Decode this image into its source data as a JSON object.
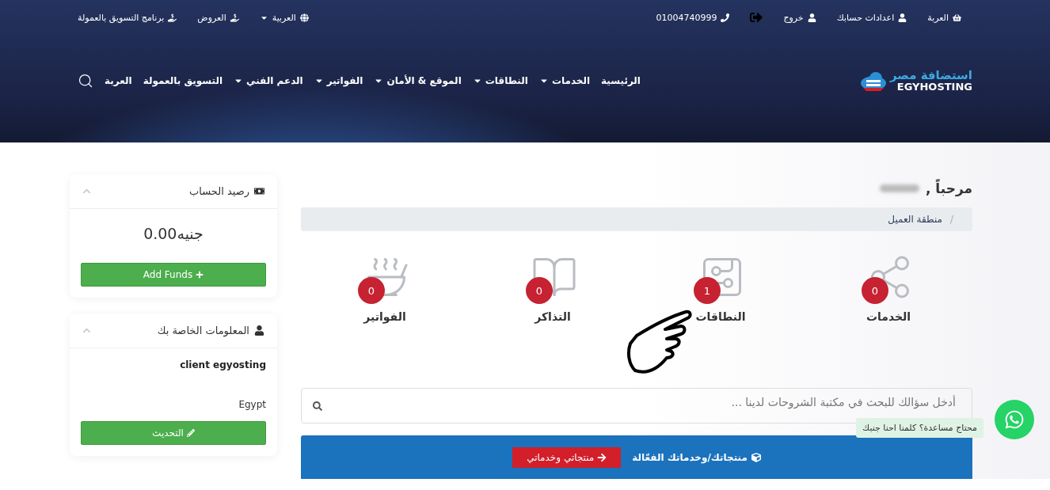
{
  "top_bar": {
    "right": [
      {
        "kind": "basket",
        "label": "العربة"
      },
      {
        "kind": "user",
        "label": "اعدادات حسابك"
      },
      {
        "kind": "user",
        "label": "خروج"
      },
      {
        "kind": "logout"
      },
      {
        "kind": "phone",
        "label": "01004740999"
      }
    ],
    "left": [
      {
        "kind": "globe",
        "label": "العربية",
        "dropdown": true
      },
      {
        "kind": "offer",
        "label": "العروض",
        "dropdown": false
      },
      {
        "kind": "offer",
        "label": "برنامج التسويق بالعمولة",
        "dropdown": false
      }
    ]
  },
  "logo": {
    "arabic": "استضافة مصر",
    "latin": "EGYHOSTING"
  },
  "nav": [
    {
      "label": "الرئيسية",
      "dropdown": false
    },
    {
      "label": "الخدمات",
      "dropdown": true
    },
    {
      "label": "النطاقات",
      "dropdown": true
    },
    {
      "label": "الموقع & الأمان",
      "dropdown": true
    },
    {
      "label": "الفواتير",
      "dropdown": true
    },
    {
      "label": "الدعم الفني",
      "dropdown": true
    },
    {
      "label": "التسويق بالعمولة",
      "dropdown": false
    },
    {
      "label": "العربة",
      "dropdown": false
    }
  ],
  "greeting": "مرحباً ,",
  "breadcrumb_separator": "/",
  "breadcrumb": [
    "منطقة العميل"
  ],
  "stats": [
    {
      "kind": "services",
      "count": "0",
      "label": "الخدمات"
    },
    {
      "kind": "domains",
      "count": "1",
      "label": "النطاقات"
    },
    {
      "kind": "tickets",
      "count": "0",
      "label": "التذاكر"
    },
    {
      "kind": "invoices",
      "count": "0",
      "label": "الفواتير"
    }
  ],
  "search": {
    "placeholder": "أدخل سؤالك للبحث في مكتبة الشروحات لدينا ..."
  },
  "products_panel": {
    "title": "منتجاتك/وخدماتك الفعّالة",
    "button": "منتجاتي وخدماتي"
  },
  "sidebar": [
    {
      "kind": "balance",
      "title": "رصيد الحساب",
      "amount": "جنيه0.00",
      "button": "Add Funds"
    },
    {
      "kind": "info",
      "title": "المعلومات الخاصة بك",
      "name": "client egyosting",
      "country": "Egypt",
      "button": "التحديث"
    }
  ],
  "whatsapp": {
    "tooltip": "محتاج مساعدة؟ كلمنا احنا جنبك"
  }
}
